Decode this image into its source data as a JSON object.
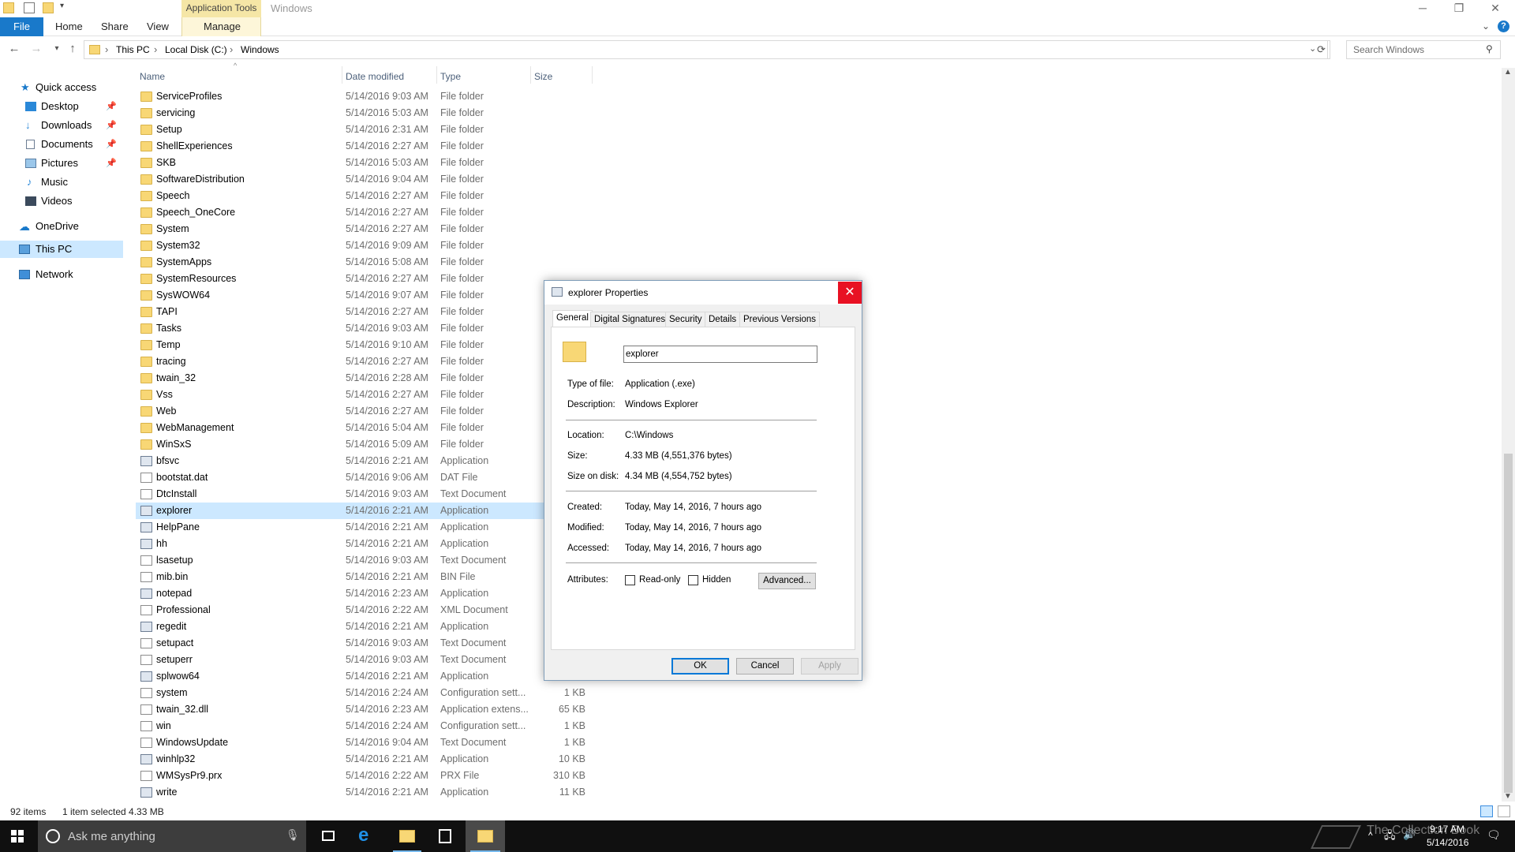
{
  "window": {
    "title": "Windows",
    "contextual_tab_group": "Application Tools",
    "controls": {
      "minimize": "─",
      "restore": "❐",
      "close": "✕"
    }
  },
  "ribbon": {
    "tabs": [
      "File",
      "Home",
      "Share",
      "View",
      "Manage"
    ],
    "help": "?"
  },
  "address": {
    "breadcrumb": [
      "This PC",
      "Local Disk (C:)",
      "Windows"
    ],
    "search_placeholder": "Search Windows"
  },
  "nav": {
    "items": [
      {
        "label": "Quick access",
        "icon": "star-icon"
      },
      {
        "label": "Desktop",
        "icon": "desktop-icon",
        "pinned": true
      },
      {
        "label": "Downloads",
        "icon": "download-icon",
        "pinned": true
      },
      {
        "label": "Documents",
        "icon": "documents-icon",
        "pinned": true
      },
      {
        "label": "Pictures",
        "icon": "pictures-icon",
        "pinned": true
      },
      {
        "label": "Music",
        "icon": "music-icon"
      },
      {
        "label": "Videos",
        "icon": "videos-icon"
      },
      {
        "label": "OneDrive",
        "icon": "cloud-icon"
      },
      {
        "label": "This PC",
        "icon": "computer-icon",
        "selected": true
      },
      {
        "label": "Network",
        "icon": "network-icon"
      }
    ]
  },
  "columns": {
    "name": "Name",
    "date": "Date modified",
    "type": "Type",
    "size": "Size"
  },
  "files": [
    {
      "name": "ServiceProfiles",
      "date": "5/14/2016 9:03 AM",
      "type": "File folder",
      "size": "",
      "kind": "folder"
    },
    {
      "name": "servicing",
      "date": "5/14/2016 5:03 AM",
      "type": "File folder",
      "size": "",
      "kind": "folder"
    },
    {
      "name": "Setup",
      "date": "5/14/2016 2:31 AM",
      "type": "File folder",
      "size": "",
      "kind": "folder"
    },
    {
      "name": "ShellExperiences",
      "date": "5/14/2016 2:27 AM",
      "type": "File folder",
      "size": "",
      "kind": "folder"
    },
    {
      "name": "SKB",
      "date": "5/14/2016 5:03 AM",
      "type": "File folder",
      "size": "",
      "kind": "folder"
    },
    {
      "name": "SoftwareDistribution",
      "date": "5/14/2016 9:04 AM",
      "type": "File folder",
      "size": "",
      "kind": "folder"
    },
    {
      "name": "Speech",
      "date": "5/14/2016 2:27 AM",
      "type": "File folder",
      "size": "",
      "kind": "folder"
    },
    {
      "name": "Speech_OneCore",
      "date": "5/14/2016 2:27 AM",
      "type": "File folder",
      "size": "",
      "kind": "folder"
    },
    {
      "name": "System",
      "date": "5/14/2016 2:27 AM",
      "type": "File folder",
      "size": "",
      "kind": "folder"
    },
    {
      "name": "System32",
      "date": "5/14/2016 9:09 AM",
      "type": "File folder",
      "size": "",
      "kind": "folder"
    },
    {
      "name": "SystemApps",
      "date": "5/14/2016 5:08 AM",
      "type": "File folder",
      "size": "",
      "kind": "folder"
    },
    {
      "name": "SystemResources",
      "date": "5/14/2016 2:27 AM",
      "type": "File folder",
      "size": "",
      "kind": "folder"
    },
    {
      "name": "SysWOW64",
      "date": "5/14/2016 9:07 AM",
      "type": "File folder",
      "size": "",
      "kind": "folder"
    },
    {
      "name": "TAPI",
      "date": "5/14/2016 2:27 AM",
      "type": "File folder",
      "size": "",
      "kind": "folder"
    },
    {
      "name": "Tasks",
      "date": "5/14/2016 9:03 AM",
      "type": "File folder",
      "size": "",
      "kind": "folder"
    },
    {
      "name": "Temp",
      "date": "5/14/2016 9:10 AM",
      "type": "File folder",
      "size": "",
      "kind": "folder"
    },
    {
      "name": "tracing",
      "date": "5/14/2016 2:27 AM",
      "type": "File folder",
      "size": "",
      "kind": "folder"
    },
    {
      "name": "twain_32",
      "date": "5/14/2016 2:28 AM",
      "type": "File folder",
      "size": "",
      "kind": "folder"
    },
    {
      "name": "Vss",
      "date": "5/14/2016 2:27 AM",
      "type": "File folder",
      "size": "",
      "kind": "folder"
    },
    {
      "name": "Web",
      "date": "5/14/2016 2:27 AM",
      "type": "File folder",
      "size": "",
      "kind": "folder"
    },
    {
      "name": "WebManagement",
      "date": "5/14/2016 5:04 AM",
      "type": "File folder",
      "size": "",
      "kind": "folder"
    },
    {
      "name": "WinSxS",
      "date": "5/14/2016 5:09 AM",
      "type": "File folder",
      "size": "",
      "kind": "folder"
    },
    {
      "name": "bfsvc",
      "date": "5/14/2016 2:21 AM",
      "type": "Application",
      "size": "",
      "kind": "app"
    },
    {
      "name": "bootstat.dat",
      "date": "5/14/2016 9:06 AM",
      "type": "DAT File",
      "size": "",
      "kind": "doc"
    },
    {
      "name": "DtcInstall",
      "date": "5/14/2016 9:03 AM",
      "type": "Text Document",
      "size": "",
      "kind": "doc"
    },
    {
      "name": "explorer",
      "date": "5/14/2016 2:21 AM",
      "type": "Application",
      "size": "",
      "kind": "app",
      "selected": true
    },
    {
      "name": "HelpPane",
      "date": "5/14/2016 2:21 AM",
      "type": "Application",
      "size": "",
      "kind": "help"
    },
    {
      "name": "hh",
      "date": "5/14/2016 2:21 AM",
      "type": "Application",
      "size": "",
      "kind": "app"
    },
    {
      "name": "lsasetup",
      "date": "5/14/2016 9:03 AM",
      "type": "Text Document",
      "size": "",
      "kind": "doc"
    },
    {
      "name": "mib.bin",
      "date": "5/14/2016 2:21 AM",
      "type": "BIN File",
      "size": "",
      "kind": "doc"
    },
    {
      "name": "notepad",
      "date": "5/14/2016 2:23 AM",
      "type": "Application",
      "size": "",
      "kind": "app"
    },
    {
      "name": "Professional",
      "date": "5/14/2016 2:22 AM",
      "type": "XML Document",
      "size": "",
      "kind": "doc"
    },
    {
      "name": "regedit",
      "date": "5/14/2016 2:21 AM",
      "type": "Application",
      "size": "",
      "kind": "app"
    },
    {
      "name": "setupact",
      "date": "5/14/2016 9:03 AM",
      "type": "Text Document",
      "size": "",
      "kind": "doc"
    },
    {
      "name": "setuperr",
      "date": "5/14/2016 9:03 AM",
      "type": "Text Document",
      "size": "",
      "kind": "doc"
    },
    {
      "name": "splwow64",
      "date": "5/14/2016 2:21 AM",
      "type": "Application",
      "size": "",
      "kind": "app"
    },
    {
      "name": "system",
      "date": "5/14/2016 2:24 AM",
      "type": "Configuration sett...",
      "size": "1 KB",
      "kind": "doc"
    },
    {
      "name": "twain_32.dll",
      "date": "5/14/2016 2:23 AM",
      "type": "Application extens...",
      "size": "65 KB",
      "kind": "doc"
    },
    {
      "name": "win",
      "date": "5/14/2016 2:24 AM",
      "type": "Configuration sett...",
      "size": "1 KB",
      "kind": "doc"
    },
    {
      "name": "WindowsUpdate",
      "date": "5/14/2016 9:04 AM",
      "type": "Text Document",
      "size": "1 KB",
      "kind": "doc"
    },
    {
      "name": "winhlp32",
      "date": "5/14/2016 2:21 AM",
      "type": "Application",
      "size": "10 KB",
      "kind": "help"
    },
    {
      "name": "WMSysPr9.prx",
      "date": "5/14/2016 2:22 AM",
      "type": "PRX File",
      "size": "310 KB",
      "kind": "doc"
    },
    {
      "name": "write",
      "date": "5/14/2016 2:21 AM",
      "type": "Application",
      "size": "11 KB",
      "kind": "app"
    }
  ],
  "status": {
    "count": "92 items",
    "selected": "1 item selected  4.33 MB"
  },
  "taskbar": {
    "search_placeholder": "Ask me anything",
    "time": "9:17 AM",
    "date": "5/14/2016",
    "watermark": "The Collection Book"
  },
  "dialog": {
    "title": "explorer Properties",
    "close": "✕",
    "tabs": [
      "General",
      "Digital Signatures",
      "Security",
      "Details",
      "Previous Versions"
    ],
    "name_value": "explorer",
    "type_label": "Type of file:",
    "type_value": "Application (.exe)",
    "desc_label": "Description:",
    "desc_value": "Windows Explorer",
    "loc_label": "Location:",
    "loc_value": "C:\\Windows",
    "size_label": "Size:",
    "size_value": "4.33 MB (4,551,376 bytes)",
    "disk_label": "Size on disk:",
    "disk_value": "4.34 MB (4,554,752 bytes)",
    "created_label": "Created:",
    "created_value": "Today, May 14, 2016, 7 hours ago",
    "modified_label": "Modified:",
    "modified_value": "Today, May 14, 2016, 7 hours ago",
    "accessed_label": "Accessed:",
    "accessed_value": "Today, May 14, 2016, 7 hours ago",
    "attr_label": "Attributes:",
    "readonly_label": "Read-only",
    "hidden_label": "Hidden",
    "advanced": "Advanced...",
    "ok": "OK",
    "cancel": "Cancel",
    "apply": "Apply"
  },
  "colors": {
    "accent": "#1979ca",
    "selection": "#cce8ff",
    "close_red": "#e81123",
    "folder": "#f8d775"
  }
}
